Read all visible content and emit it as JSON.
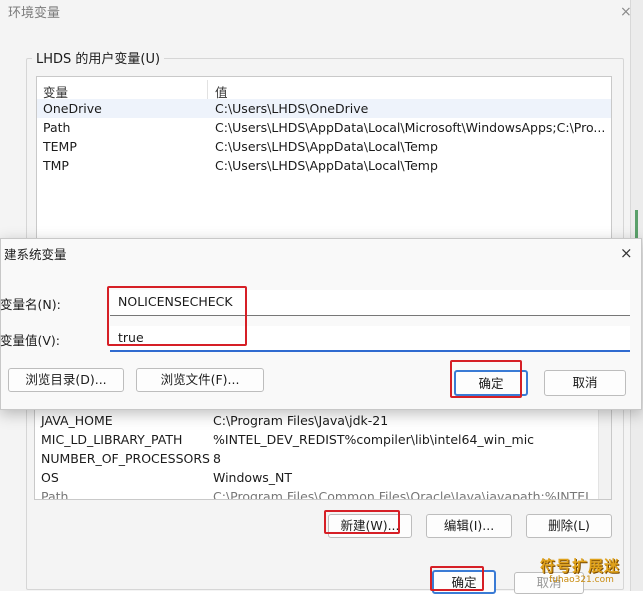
{
  "env_dialog": {
    "title": "环境变量",
    "close_icon": "×",
    "user_group_title": "LHDS 的用户变量(U)",
    "columns": [
      "变量",
      "值"
    ],
    "user_vars": [
      {
        "name": "OneDrive",
        "value": "C:\\Users\\LHDS\\OneDrive"
      },
      {
        "name": "Path",
        "value": "C:\\Users\\LHDS\\AppData\\Local\\Microsoft\\WindowsApps;C:\\Pro..."
      },
      {
        "name": "TEMP",
        "value": "C:\\Users\\LHDS\\AppData\\Local\\Temp"
      },
      {
        "name": "TMP",
        "value": "C:\\Users\\LHDS\\AppData\\Local\\Temp"
      }
    ],
    "system_vars": [
      {
        "name": "JAVA_HOME",
        "value": "C:\\Program Files\\Java\\jdk-21"
      },
      {
        "name": "MIC_LD_LIBRARY_PATH",
        "value": "%INTEL_DEV_REDIST%compiler\\lib\\intel64_win_mic"
      },
      {
        "name": "NUMBER_OF_PROCESSORS",
        "value": "8"
      },
      {
        "name": "OS",
        "value": "Windows_NT"
      },
      {
        "name": "Path",
        "value": "C:\\Program Files\\Common Files\\Oracle\\Java\\javapath;%INTEL_D..."
      }
    ],
    "system_buttons": {
      "new": "新建(W)...",
      "edit": "编辑(I)...",
      "delete": "删除(L)"
    },
    "bottom_buttons": {
      "ok": "确定",
      "cancel": "取消"
    }
  },
  "new_var_dialog": {
    "title": "建系统变量",
    "close_icon": "×",
    "name_label": "变量名(N):",
    "value_label": "变量值(V):",
    "name_value": "NOLICENSECHECK",
    "value_value": "true",
    "browse_dir": "浏览目录(D)...",
    "browse_file": "浏览文件(F)...",
    "ok": "确定",
    "cancel": "取消"
  },
  "watermark": {
    "text": "符号扩展迷",
    "url": "fuhao321.com"
  },
  "colors": {
    "highlight": "#d61f26",
    "accent": "#2f6bd0"
  }
}
